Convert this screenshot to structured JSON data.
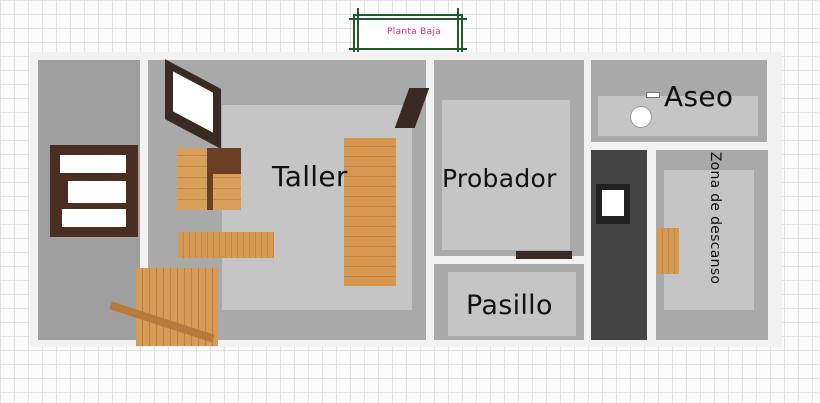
{
  "floor_plan": {
    "level_title": "Planta Baja",
    "rooms": {
      "taller": "Taller",
      "probador": "Probador",
      "aseo": "Aseo",
      "zona_descanso": "Zona de descanso",
      "pasillo": "Pasillo"
    }
  },
  "colors": {
    "grid_background": "#fbfbfb",
    "walls": "#ffffff",
    "floor": "#a9a9a9",
    "title_text": "#e0306a",
    "title_frame": "#1f5a2a"
  }
}
